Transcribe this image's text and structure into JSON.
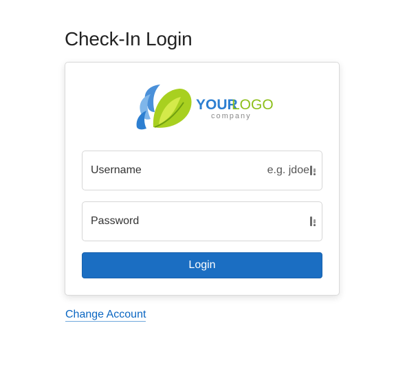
{
  "page": {
    "title": "Check-In Login"
  },
  "logo": {
    "text_main_part1": "YOUR",
    "text_main_part2": "LOGO",
    "text_sub": "company",
    "colors": {
      "blue": "#2d7fd1",
      "green": "#8dbf1a"
    }
  },
  "form": {
    "username": {
      "label": "Username",
      "placeholder": "e.g. jdoe",
      "icon": "password-manager-icon"
    },
    "password": {
      "label": "Password",
      "placeholder": "",
      "icon": "password-manager-icon"
    },
    "login_label": "Login"
  },
  "links": {
    "change_account": "Change Account"
  },
  "colors": {
    "primary": "#1b6ec2",
    "link": "#0a66c2"
  }
}
